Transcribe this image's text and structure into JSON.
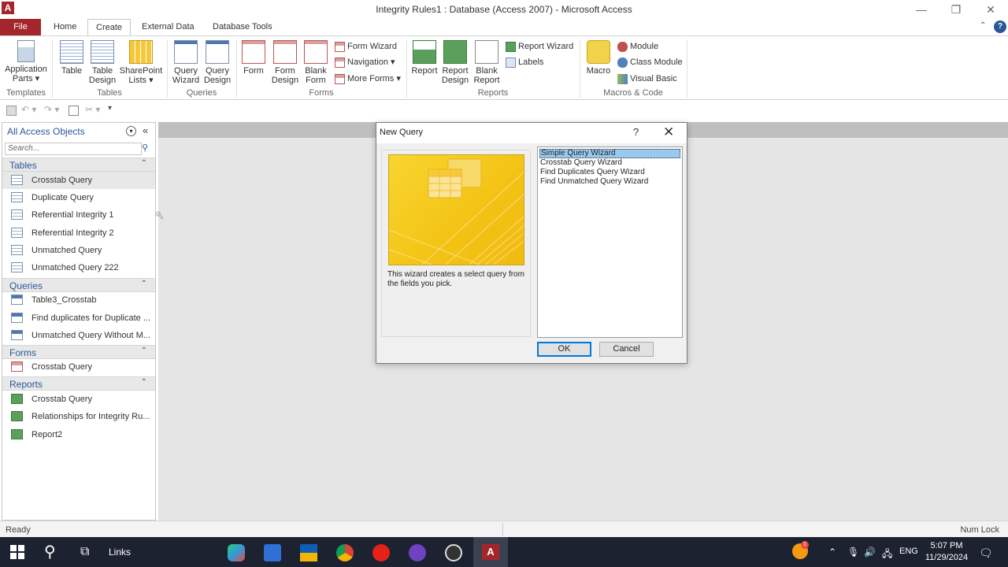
{
  "window": {
    "app_icon": "A",
    "title": "Integrity Rules1 : Database (Access 2007) - Microsoft Access",
    "minimize": "—",
    "restore": "❐",
    "close": "✕"
  },
  "tabs": {
    "file": "File",
    "home": "Home",
    "create": "Create",
    "external": "External Data",
    "dbtools": "Database Tools"
  },
  "ribbon": {
    "groups": {
      "templates": "Templates",
      "tables": "Tables",
      "queries": "Queries",
      "forms": "Forms",
      "reports": "Reports",
      "macros": "Macros & Code"
    },
    "application_parts": [
      "Application",
      "Parts ▾"
    ],
    "table": "Table",
    "table_design": [
      "Table",
      "Design"
    ],
    "sharepoint_lists": [
      "SharePoint",
      "Lists ▾"
    ],
    "query_wizard": [
      "Query",
      "Wizard"
    ],
    "query_design": [
      "Query",
      "Design"
    ],
    "form": "Form",
    "form_design": [
      "Form",
      "Design"
    ],
    "blank_form": [
      "Blank",
      "Form"
    ],
    "form_wizard": "Form Wizard",
    "navigation": "Navigation ▾",
    "more_forms": "More Forms ▾",
    "report": "Report",
    "report_design": [
      "Report",
      "Design"
    ],
    "blank_report": [
      "Blank",
      "Report"
    ],
    "report_wizard": "Report Wizard",
    "labels": "Labels",
    "macro": "Macro",
    "module": "Module",
    "class_module": "Class Module",
    "visual_basic": "Visual Basic"
  },
  "navpane": {
    "title": "All Access Objects",
    "search_placeholder": "Search...",
    "sections": {
      "tables": "Tables",
      "queries": "Queries",
      "forms": "Forms",
      "reports": "Reports"
    },
    "tables": [
      "Crosstab Query",
      "Duplicate Query",
      "Referential Integrity 1",
      "Referential Integrity 2",
      "Unmatched Query",
      "Unmatched Query 222"
    ],
    "queries": [
      "Table3_Crosstab",
      "Find duplicates for Duplicate ...",
      "Unmatched Query Without M..."
    ],
    "forms": [
      "Crosstab Query"
    ],
    "reports": [
      "Crosstab Query",
      "Relationships for Integrity Ru...",
      "Report2"
    ]
  },
  "dialog": {
    "title": "New Query",
    "help": "?",
    "close": "✕",
    "description": "This wizard creates a select query from the fields you pick.",
    "options": [
      "Simple Query Wizard",
      "Crosstab Query Wizard",
      "Find Duplicates Query Wizard",
      "Find Unmatched Query Wizard"
    ],
    "selected_index": 0,
    "ok": "OK",
    "cancel": "Cancel"
  },
  "status": {
    "left": "Ready",
    "right": "Num Lock"
  },
  "taskbar": {
    "links": "Links",
    "lang": "ENG",
    "time": "5:07 PM",
    "date": "11/29/2024",
    "notification_count": "1"
  },
  "colors": {
    "file_tab": "#a4262c",
    "nav_heading": "#2b5797",
    "selection": "#99c9ef",
    "taskbar": "#1c2230"
  }
}
